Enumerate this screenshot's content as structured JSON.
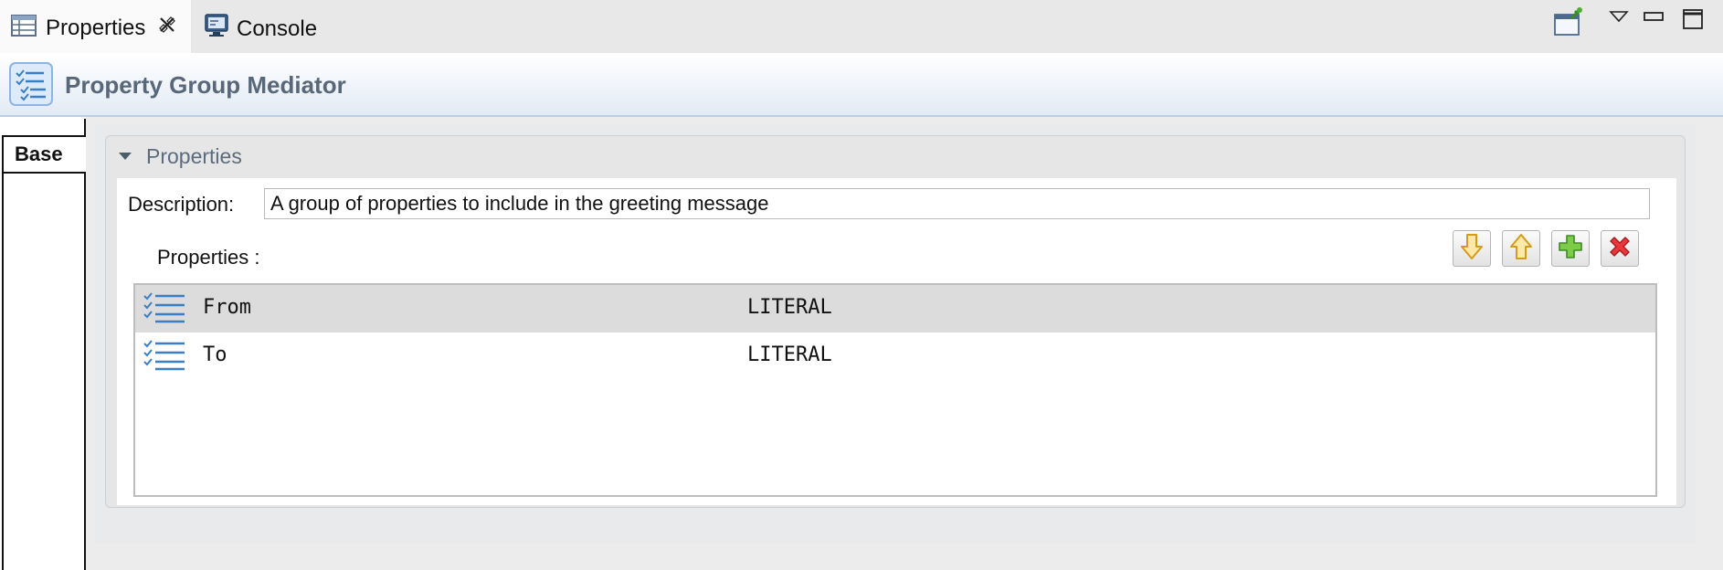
{
  "tabs": [
    {
      "label": "Properties",
      "icon": "properties-table-icon",
      "active": true,
      "closable": true
    },
    {
      "label": "Console",
      "icon": "console-monitor-icon",
      "active": false
    }
  ],
  "window_controls": [
    "pin-view-icon",
    "view-menu-icon",
    "minimize-icon",
    "maximize-icon"
  ],
  "header": {
    "title": "Property Group Mediator",
    "icon": "property-group-icon"
  },
  "section_tabs": [
    {
      "label": "Base",
      "selected": true
    }
  ],
  "section": {
    "title": "Properties",
    "expanded": true,
    "description_label": "Description:",
    "description_value": "A group of properties to include in the greeting message",
    "properties_label": "Properties :",
    "toolbar": [
      {
        "name": "move-down-button",
        "icon": "arrow-down-icon",
        "color": "#e8b23c"
      },
      {
        "name": "move-up-button",
        "icon": "arrow-up-icon",
        "color": "#e8b23c"
      },
      {
        "name": "add-button",
        "icon": "plus-icon",
        "color": "#4caf2f"
      },
      {
        "name": "delete-button",
        "icon": "red-x-icon",
        "color": "#d9262a"
      }
    ],
    "rows": [
      {
        "name": "From",
        "type": "LITERAL",
        "selected": true
      },
      {
        "name": "To",
        "type": "LITERAL",
        "selected": false
      }
    ]
  },
  "colors": {
    "header_title": "#58687a",
    "section_title": "#5c6b7d",
    "accent_border": "#b9cde6"
  }
}
